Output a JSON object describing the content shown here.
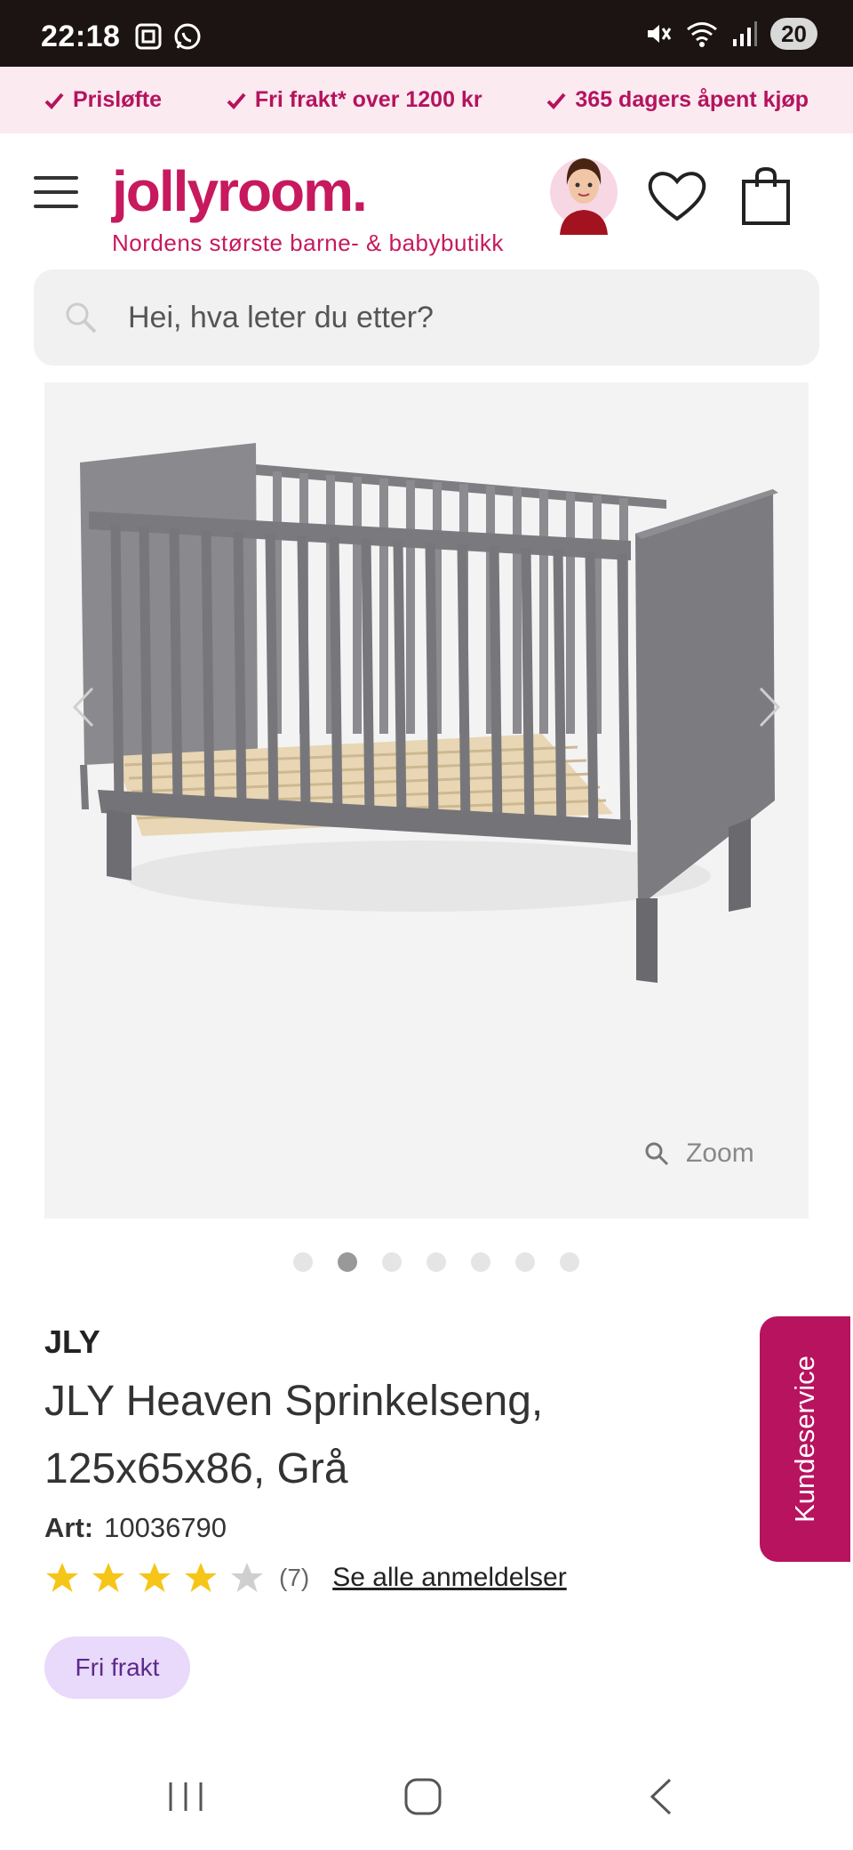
{
  "status_bar": {
    "time": "22:18",
    "battery": "20"
  },
  "promo": {
    "items": [
      "Prisløfte",
      "Fri frakt* over 1200 kr",
      "365 dagers åpent kjøp"
    ],
    "color": "#b5135e"
  },
  "header": {
    "logo": "jollyroom.",
    "tagline": "Nordens største barne- & babybutikk",
    "brand_color": "#c7195d"
  },
  "search": {
    "placeholder": "Hei, hva leter du etter?"
  },
  "gallery": {
    "zoom_label": "Zoom",
    "image_count": 7,
    "active_index": 1
  },
  "product": {
    "brand": "JLY",
    "title": "JLY Heaven Sprinkelseng, 125x65x86, Grå",
    "art_label": "Art:",
    "art_number": "10036790",
    "rating": 4,
    "rating_max": 5,
    "review_count": "(7)",
    "reviews_link": "Se alle anmeldelser",
    "badge": "Fri frakt"
  },
  "side_tab": {
    "label": "Kundeservice",
    "color": "#b8135f"
  }
}
